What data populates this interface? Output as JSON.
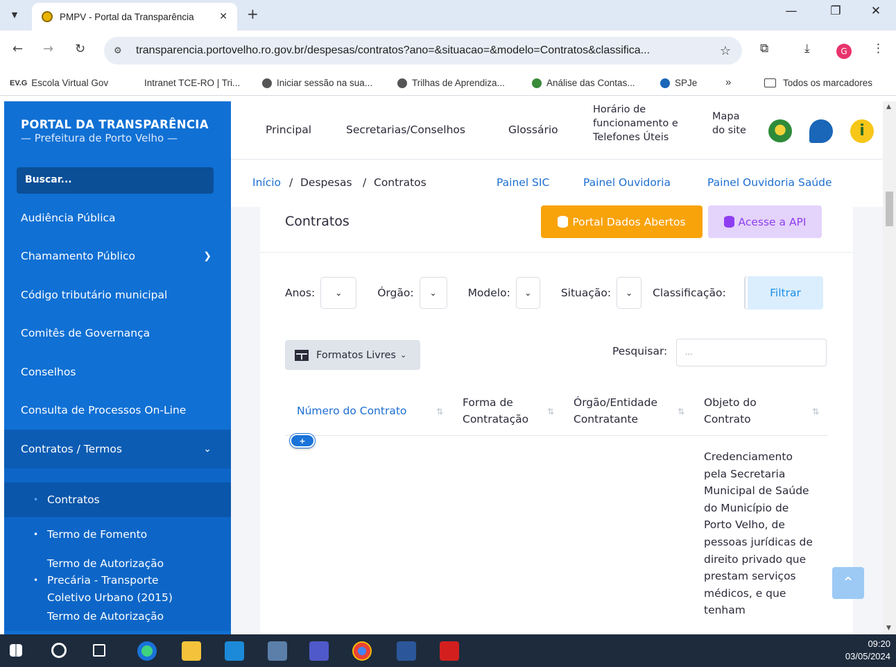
{
  "browser": {
    "tab_title": "PMPV - Portal da Transparência",
    "tab_close": "✕",
    "new_tab": "+",
    "url": "transparencia.portovelho.ro.gov.br/despesas/contratos?ano=&situacao=&modelo=Contratos&classifica...",
    "bookmarks": [
      {
        "label": "Escola Virtual Gov",
        "prefix": "EV.G"
      },
      {
        "label": "Intranet TCE-RO | Tri..."
      },
      {
        "label": "Iniciar sessão na sua..."
      },
      {
        "label": "Trilhas de Aprendiza..."
      },
      {
        "label": "Análise das Contas..."
      },
      {
        "label": "SPJe"
      }
    ],
    "bookmarks_more": "»",
    "all_bookmarks": "Todos os marcadores",
    "profile_initial": "G"
  },
  "sidebar": {
    "brand_title": "PORTAL DA TRANSPARÊNCIA",
    "brand_subtitle": "— Prefeitura de Porto Velho —",
    "search_label": "Buscar...",
    "items": [
      {
        "label": "Audiência Pública"
      },
      {
        "label": "Chamamento Público"
      },
      {
        "label": "Código tributário municipal"
      },
      {
        "label": "Comitês de Governança"
      },
      {
        "label": "Conselhos"
      },
      {
        "label": "Consulta de Processos On-Line"
      },
      {
        "label": "Contratos / Termos"
      }
    ],
    "sub_items": [
      {
        "label": "Contratos"
      },
      {
        "label": "Termo de Fomento"
      },
      {
        "label": "Termo de Autorização Precária - Transporte Coletivo Urbano (2015)"
      },
      {
        "label": "Termo de Autorização"
      }
    ]
  },
  "topnav": {
    "principal": "Principal",
    "secretarias": "Secretarias/Conselhos",
    "glossario": "Glossário",
    "horario": "Horário de funcionamento e Telefones Úteis",
    "mapa": "Mapa do site"
  },
  "breadcrumb": {
    "inicio": "Início",
    "sep": "/",
    "despesas": "Despesas",
    "contratos": "Contratos"
  },
  "quick_links": {
    "sic": "Painel SIC",
    "ouvidoria": "Painel Ouvidoria",
    "ouvidoria_saude": "Painel Ouvidoria Saúde"
  },
  "card": {
    "title": "Contratos",
    "btn_open_data": "Portal Dados Abertos",
    "btn_api": "Acesse a API"
  },
  "filters": {
    "anos": "Anos:",
    "orgao": "Órgão:",
    "modelo": "Modelo:",
    "situacao": "Situação:",
    "classificacao": "Classificação:",
    "filtrar": "Filtrar"
  },
  "table_tools": {
    "formats": "Formatos Livres",
    "search_label": "Pesquisar:",
    "search_placeholder": "..."
  },
  "table": {
    "col1": "Número do Contrato",
    "col2": "Forma de Contratação",
    "col3": "Órgão/Entidade Contratante",
    "col4": "Objeto do Contrato",
    "row1_objeto": "Credenciamento pela Secretaria Municipal de Saúde do Município de Porto Velho, de pessoas jurídicas de direito privado que prestam serviços médicos, e que tenham"
  },
  "taskbar": {
    "time": "09:20",
    "date": "03/05/2024"
  },
  "colors": {
    "sidebar": "#1070d4",
    "accent_blue": "#1d6fd1",
    "open_data": "#f9a30a",
    "api": "#e4d3fb"
  }
}
